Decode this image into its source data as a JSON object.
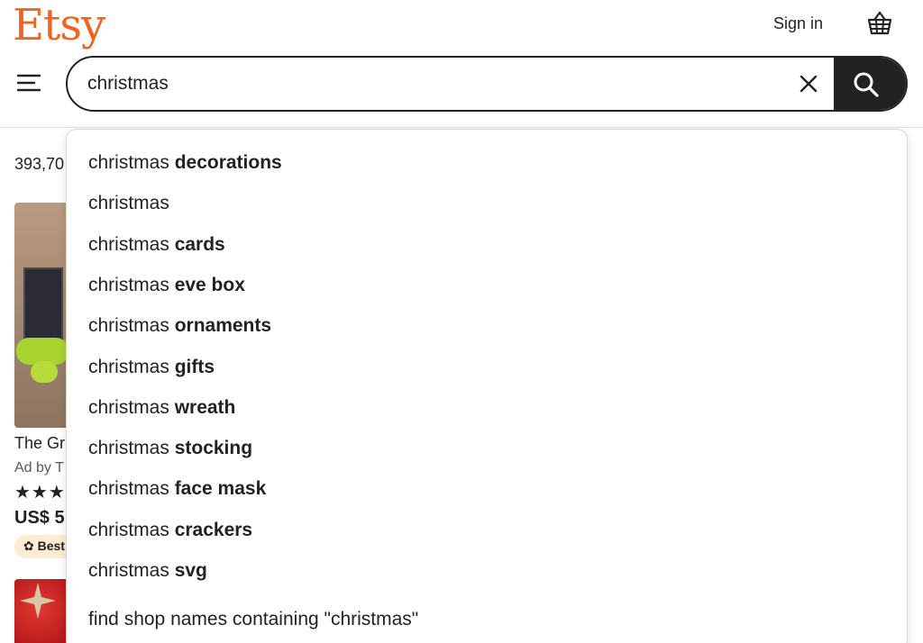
{
  "header": {
    "logo": "Etsy",
    "sign_in": "Sign in",
    "cart_icon": "shopping-basket-icon",
    "menu_icon": "hamburger-menu-icon"
  },
  "search": {
    "value": "christmas",
    "clear_icon": "close-icon",
    "submit_icon": "search-icon"
  },
  "background": {
    "results_count": "393,70",
    "product_title": "The Gr",
    "product_ad": "Ad by T",
    "product_stars": "★★★",
    "product_price": "US$ 5",
    "product_badge": "Best"
  },
  "dropdown": {
    "suggestions": [
      {
        "prefix": "christmas ",
        "suffix": "decorations"
      },
      {
        "prefix": "christmas",
        "suffix": ""
      },
      {
        "prefix": "christmas ",
        "suffix": "cards"
      },
      {
        "prefix": "christmas ",
        "suffix": "eve box"
      },
      {
        "prefix": "christmas ",
        "suffix": "ornaments"
      },
      {
        "prefix": "christmas ",
        "suffix": "gifts"
      },
      {
        "prefix": "christmas ",
        "suffix": "wreath"
      },
      {
        "prefix": "christmas ",
        "suffix": "stocking"
      },
      {
        "prefix": "christmas ",
        "suffix": "face mask"
      },
      {
        "prefix": "christmas ",
        "suffix": "crackers"
      },
      {
        "prefix": "christmas ",
        "suffix": "svg"
      }
    ],
    "shop_search": "find shop names containing \"christmas\""
  },
  "colors": {
    "brand": "#f1641e",
    "search_button": "#222222",
    "badge": "#fdebd2"
  }
}
